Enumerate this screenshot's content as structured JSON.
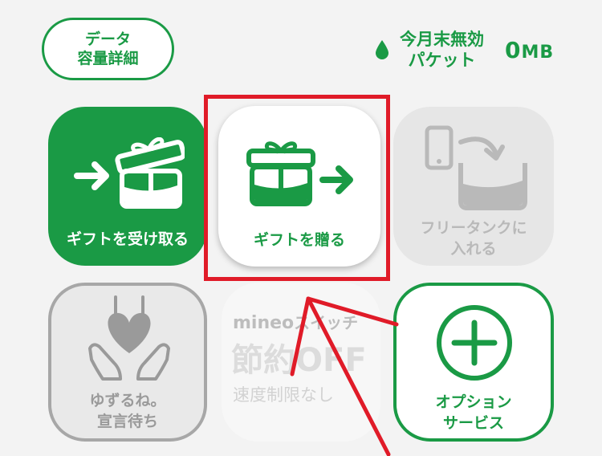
{
  "header": {
    "data_detail_button": {
      "line1": "データ",
      "line2": "容量詳細"
    },
    "expiring_packets": {
      "label_line1": "今月末無効",
      "label_line2": "パケット",
      "value": "0",
      "unit": "MB"
    }
  },
  "tiles": {
    "receive_gift": {
      "label": "ギフトを受け取る"
    },
    "send_gift": {
      "label": "ギフトを贈る"
    },
    "free_tank": {
      "label_line1": "フリータンクに",
      "label_line2": "入れる"
    },
    "yuzuru": {
      "label_line1": "ゆずるね。",
      "label_line2": "宣言待ち"
    },
    "mineo_switch": {
      "brand": "mineo",
      "brand_suffix": "スイッチ",
      "title": "節約OFF",
      "subtitle": "速度制限なし"
    },
    "option_service": {
      "label_line1": "オプション",
      "label_line2": "サービス"
    }
  },
  "colors": {
    "brand_green": "#1a9a45",
    "disabled_gray": "#b9b9b9",
    "annotation_red": "#e01b28"
  }
}
